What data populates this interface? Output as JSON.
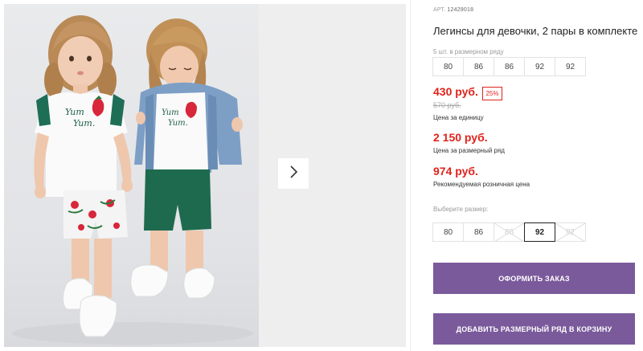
{
  "product": {
    "article_label": "АРТ.",
    "article_number": "12429018",
    "title": "Легинсы для девочки, 2 пары в комплекте"
  },
  "size_set": {
    "label": "5 шт. в размерном ряду",
    "sizes": [
      "80",
      "86",
      "86",
      "92",
      "92"
    ]
  },
  "pricing": {
    "unit_price": "430 руб.",
    "discount": "25%",
    "old_price": "570 руб.",
    "unit_caption": "Цена за единицу",
    "row_price": "2 150 руб.",
    "row_caption": "Цена за размерный ряд",
    "retail_price": "974 руб.",
    "retail_caption": "Рекомендуемая розничная цена"
  },
  "size_choice": {
    "label": "Выберите размер:",
    "options": [
      {
        "label": "80",
        "state": "available"
      },
      {
        "label": "86",
        "state": "available"
      },
      {
        "label": "86",
        "state": "disabled"
      },
      {
        "label": "92",
        "state": "selected"
      },
      {
        "label": "92",
        "state": "disabled"
      }
    ]
  },
  "actions": {
    "order_label": "ОФОРМИТЬ ЗАКАЗ",
    "add_row_label": "ДОБАВИТЬ РАЗМЕРНЫЙ РЯД В КОРЗИНУ"
  },
  "gallery": {
    "shirt_print": "Yum Yum.",
    "next_icon": "chevron-right-icon"
  },
  "colors": {
    "accent_button": "#7a5a9b",
    "price_red": "#e0231c"
  }
}
